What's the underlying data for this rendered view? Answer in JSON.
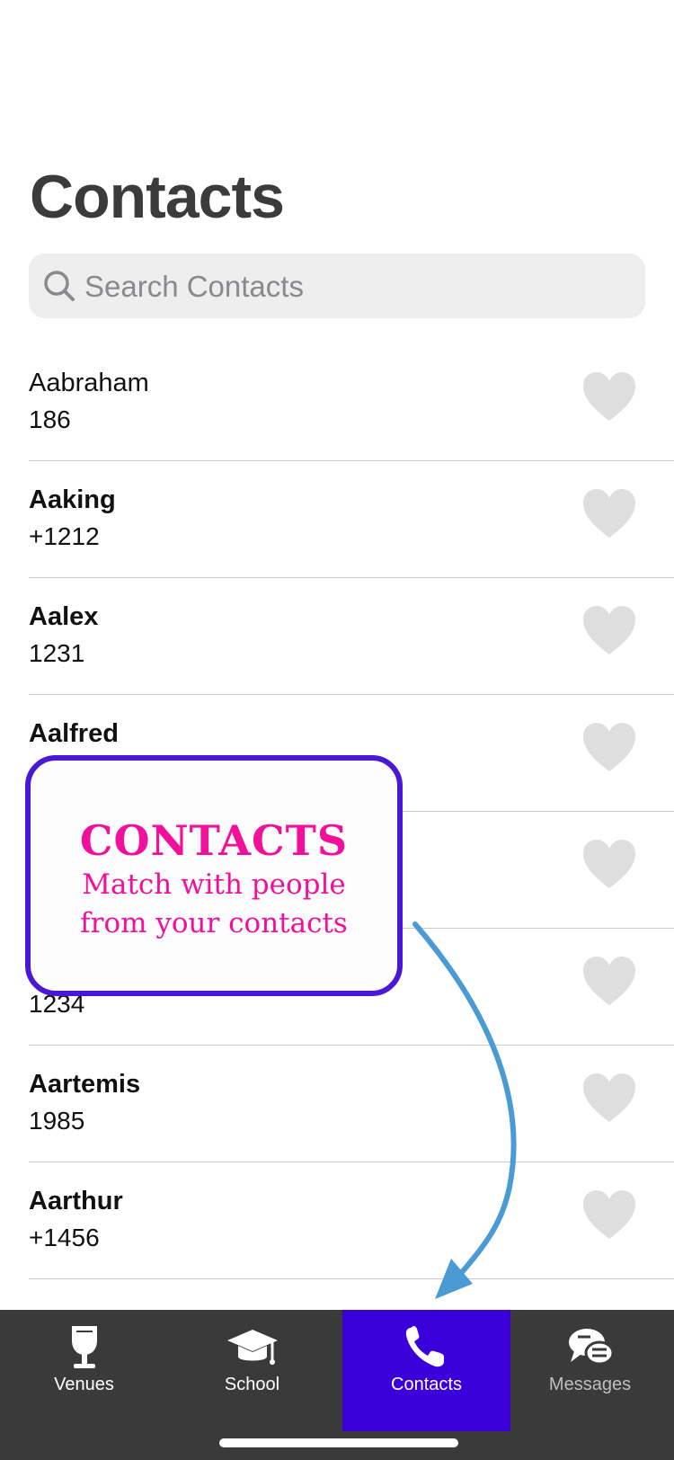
{
  "page": {
    "title": "Contacts"
  },
  "search": {
    "placeholder": "Search Contacts"
  },
  "contacts": [
    {
      "name": "Aabraham",
      "phone": "186"
    },
    {
      "name": "Aaking",
      "phone": "+1212"
    },
    {
      "name": "Aalex",
      "phone": "1231"
    },
    {
      "name": "Aalfred",
      "phone": ""
    },
    {
      "name": "",
      "phone": ""
    },
    {
      "name": "",
      "phone": "1234"
    },
    {
      "name": "Aartemis",
      "phone": "1985"
    },
    {
      "name": "Aarthur",
      "phone": "+1456"
    }
  ],
  "callout": {
    "heading": "CONTACTS",
    "line1": "Match with people",
    "line2": "from your contacts"
  },
  "tabs": [
    {
      "label": "Venues",
      "icon": "wine-glass-icon"
    },
    {
      "label": "School",
      "icon": "graduation-cap-icon"
    },
    {
      "label": "Contacts",
      "icon": "phone-icon",
      "active": true
    },
    {
      "label": "Messages",
      "icon": "chat-bubbles-icon"
    }
  ],
  "colors": {
    "accent": "#3b00d9",
    "callout_text": "#f0109a",
    "callout_border": "#4a17d6",
    "arrow": "#4a9ad4",
    "tabbar": "#3a3a3a",
    "heart": "#dedede"
  }
}
